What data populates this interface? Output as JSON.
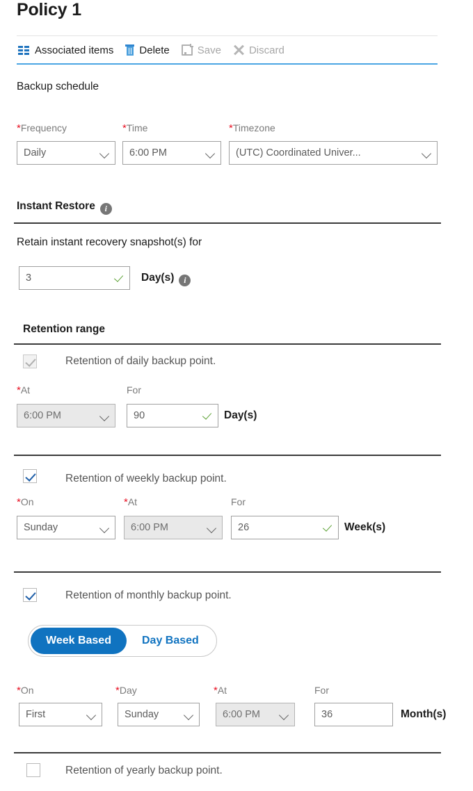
{
  "page": {
    "title": "Policy 1"
  },
  "toolbar": {
    "items": [
      {
        "label": "Associated items",
        "icon": "associated-items-icon",
        "enabled": true
      },
      {
        "label": "Delete",
        "icon": "trash-icon",
        "enabled": true
      },
      {
        "label": "Save",
        "icon": "save-icon",
        "enabled": false
      },
      {
        "label": "Discard",
        "icon": "discard-x-icon",
        "enabled": false
      }
    ]
  },
  "backup_schedule": {
    "heading": "Backup schedule",
    "frequency": {
      "label": "Frequency",
      "required": true,
      "value": "Daily"
    },
    "time": {
      "label": "Time",
      "required": true,
      "value": "6:00 PM"
    },
    "timezone": {
      "label": "Timezone",
      "required": true,
      "value": "(UTC) Coordinated Univer..."
    }
  },
  "instant_restore": {
    "heading": "Instant Restore",
    "info_icon": "info-icon",
    "retain_label": "Retain instant recovery snapshot(s) for",
    "retain_value": "3",
    "retain_unit": "Day(s)",
    "retain_unit_info_icon": "info-icon"
  },
  "retention_range": {
    "heading": "Retention range",
    "daily": {
      "checkbox_label": "Retention of daily backup point.",
      "checked": true,
      "enabled": false,
      "at": {
        "label": "At",
        "required": true,
        "value": "6:00 PM",
        "enabled": false
      },
      "for": {
        "label": "For",
        "required": false,
        "value": "90",
        "valid": true
      },
      "unit": "Day(s)"
    },
    "weekly": {
      "checkbox_label": "Retention of weekly backup point.",
      "checked": true,
      "enabled": true,
      "on": {
        "label": "On",
        "required": true,
        "value": "Sunday",
        "enabled": true
      },
      "at": {
        "label": "At",
        "required": true,
        "value": "6:00 PM",
        "enabled": false
      },
      "for": {
        "label": "For",
        "required": false,
        "value": "26",
        "valid": true
      },
      "unit": "Week(s)"
    },
    "monthly": {
      "checkbox_label": "Retention of monthly backup point.",
      "checked": true,
      "enabled": true,
      "mode_toggle": {
        "selected": "Week Based",
        "options": [
          "Week Based",
          "Day Based"
        ]
      },
      "on": {
        "label": "On",
        "required": true,
        "value": "First",
        "enabled": true
      },
      "day": {
        "label": "Day",
        "required": true,
        "value": "Sunday",
        "enabled": true
      },
      "at": {
        "label": "At",
        "required": true,
        "value": "6:00 PM",
        "enabled": false
      },
      "for": {
        "label": "For",
        "required": false,
        "value": "36",
        "valid": false
      },
      "unit": "Month(s)"
    },
    "yearly": {
      "checkbox_label": "Retention of yearly backup point.",
      "checked": false,
      "enabled": true
    }
  },
  "colors": {
    "accent_blue": "#1073c0",
    "toolbar_underline": "#4aa5e3",
    "required_red": "#e81123",
    "valid_green": "#5aa032",
    "rule_dark": "#3a3a3a"
  }
}
